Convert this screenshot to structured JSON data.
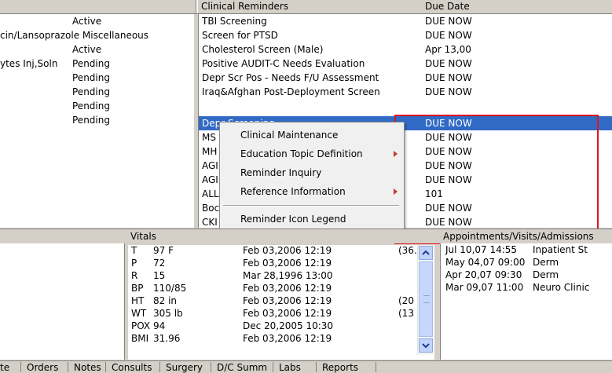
{
  "meds": {
    "rows": [
      {
        "name": "",
        "status": "Active"
      },
      {
        "name": "cin/Lansoprazole Miscellaneous",
        "status": ""
      },
      {
        "name": "",
        "status": "Active"
      },
      {
        "name": "ytes Inj,Soln",
        "status": "Pending"
      },
      {
        "name": "",
        "status": "Pending"
      },
      {
        "name": "",
        "status": "Pending"
      },
      {
        "name": "",
        "status": "Pending"
      },
      {
        "name": "",
        "status": "Pending"
      }
    ]
  },
  "reminders": {
    "header_title": "Clinical Reminders",
    "header_due": "Due Date",
    "rows": [
      {
        "name": "TBI Screening",
        "due": "DUE NOW"
      },
      {
        "name": "Screen for PTSD",
        "due": "DUE NOW"
      },
      {
        "name": "Cholesterol Screen (Male)",
        "due": "Apr 13,00"
      },
      {
        "name": "Positive AUDIT-C Needs Evaluation",
        "due": "DUE NOW"
      },
      {
        "name": "Depr Scr Pos - Needs F/U Assessment",
        "due": "DUE NOW"
      },
      {
        "name": "Iraq&Afghan Post-Deployment Screen",
        "due": "DUE NOW"
      },
      {
        "name": "Depr Screening",
        "due": "DUE NOW"
      },
      {
        "name": "MS",
        "due": "DUE NOW"
      },
      {
        "name": "MH",
        "due": "DUE NOW"
      },
      {
        "name": "AGI",
        "due": "DUE NOW"
      },
      {
        "name": "AGI",
        "due": "DUE NOW"
      },
      {
        "name": "ALL",
        "due": "101"
      },
      {
        "name": "Boc",
        "due": "DUE NOW"
      },
      {
        "name": "CKI",
        "due": "DUE NOW"
      }
    ],
    "selected_index": 6
  },
  "context_menu": {
    "items": [
      {
        "label": "Clinical Maintenance",
        "submenu": false
      },
      {
        "label": "Education Topic Definition",
        "submenu": true
      },
      {
        "label": "Reminder Inquiry",
        "submenu": false
      },
      {
        "label": "Reference Information",
        "submenu": true
      },
      {
        "label": "Reminder Icon Legend",
        "submenu": false
      }
    ]
  },
  "vitals": {
    "header": "Vitals",
    "rows": [
      {
        "code": "T",
        "value": "97 F",
        "date": "Feb 03,2006 12:19",
        "extra": "(36."
      },
      {
        "code": "P",
        "value": "72",
        "date": "Feb 03,2006 12:19",
        "extra": ""
      },
      {
        "code": "R",
        "value": "15",
        "date": "Mar 28,1996 13:00",
        "extra": ""
      },
      {
        "code": "BP",
        "value": "110/85",
        "date": "Feb 03,2006 12:19",
        "extra": ""
      },
      {
        "code": "HT",
        "value": "82 in",
        "date": "Feb 03,2006 12:19",
        "extra": "(20"
      },
      {
        "code": "WT",
        "value": "305 lb",
        "date": "Feb 03,2006 12:19",
        "extra": "(13"
      },
      {
        "code": "POX",
        "value": "94",
        "date": "Dec 20,2005 10:30",
        "extra": ""
      },
      {
        "code": "BMI",
        "value": "31.96",
        "date": "Feb 03,2006 12:19",
        "extra": ""
      }
    ]
  },
  "appointments": {
    "header": "Appointments/Visits/Admissions",
    "rows": [
      {
        "date": "Jul 10,07 14:55",
        "loc": "Inpatient St"
      },
      {
        "date": "May 04,07 09:00",
        "loc": "Derm"
      },
      {
        "date": "Apr 20,07 09:30",
        "loc": "Derm"
      },
      {
        "date": "Mar 09,07 11:00",
        "loc": "Neuro Clinic"
      }
    ]
  },
  "tabs": [
    "te",
    "Orders",
    "Notes",
    "Consults",
    "Surgery",
    "D/C Summ",
    "Labs",
    "Reports"
  ],
  "colors": {
    "selection": "#316ac5",
    "highlight_box": "#e0141e",
    "submenu_arrow": "#c0392b"
  }
}
